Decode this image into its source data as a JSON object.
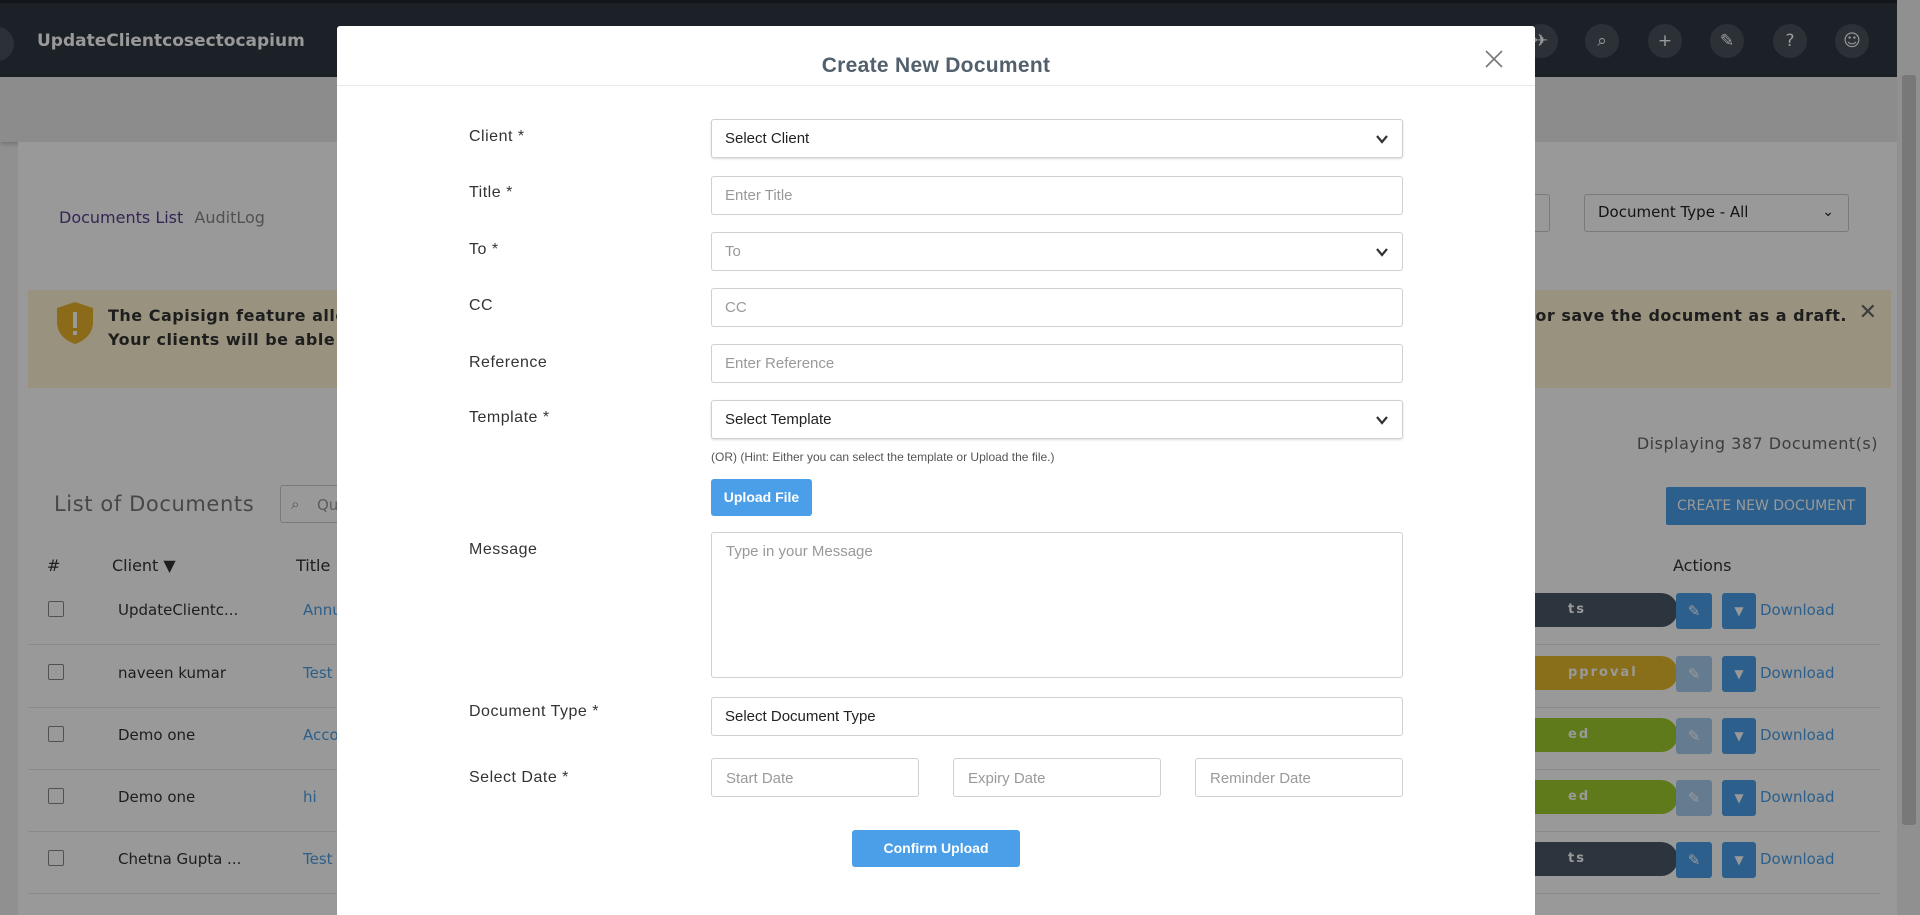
{
  "app": {
    "title": "UpdateClientcosectocapium",
    "tabs": [
      {
        "label": "Documents List"
      },
      {
        "label": "AuditLog"
      }
    ],
    "doctype_filter": "Document Type - All"
  },
  "notice": {
    "line1": "The Capisign feature allows",
    "line2": "Your clients will be able to s",
    "line1_right": "eject or save the document as a draft."
  },
  "list": {
    "displaying": "Displaying 387 Document(s)",
    "title": "List of Documents",
    "search_placeholder": "Qu",
    "create_button": "CREATE NEW DOCUMENT",
    "headers": {
      "num": "#",
      "client": "Client ▼",
      "title": "Title",
      "actions": "Actions"
    },
    "rows": [
      {
        "client": "UpdateClientc...",
        "title": "Annu",
        "status": "ts",
        "status_color": "#4a5866",
        "edit_dim": false,
        "download": "Download"
      },
      {
        "client": "naveen kumar",
        "title": "Test",
        "status": "pproval",
        "status_color": "#e6b92c",
        "edit_dim": true,
        "download": "Download"
      },
      {
        "client": "Demo one",
        "title": "Acco",
        "status": "ed",
        "status_color": "#9ecb2c",
        "edit_dim": true,
        "download": "Download"
      },
      {
        "client": "Demo one",
        "title": "hi",
        "status": "ed",
        "status_color": "#9ecb2c",
        "edit_dim": true,
        "download": "Download"
      },
      {
        "client": "Chetna Gupta ...",
        "title": "Test",
        "status": "ts",
        "status_color": "#4a5866",
        "edit_dim": false,
        "download": "Download"
      }
    ]
  },
  "modal": {
    "title": "Create New Document",
    "fields": {
      "client": {
        "label": "Client *",
        "value": "Select Client"
      },
      "title": {
        "label": "Title *",
        "placeholder": "Enter Title"
      },
      "to": {
        "label": "To *",
        "placeholder": "To"
      },
      "cc": {
        "label": "CC",
        "placeholder": "CC"
      },
      "reference": {
        "label": "Reference",
        "placeholder": "Enter Reference"
      },
      "template": {
        "label": "Template *",
        "value": "Select Template"
      },
      "message": {
        "label": "Message",
        "placeholder": "Type in your Message"
      },
      "document_type": {
        "label": "Document Type *",
        "value": "Select Document Type"
      },
      "select_date": {
        "label": "Select Date *"
      }
    },
    "hint": "(OR)   (Hint: Either you can select the template or Upload the file.)",
    "upload_button": "Upload File",
    "dates": {
      "start": "Start Date",
      "expiry": "Expiry Date",
      "reminder": "Reminder Date"
    },
    "confirm_button": "Confirm Upload"
  },
  "colors": {
    "accent": "#4a9fe8",
    "topbar": "#2f3742",
    "title": "#52606d"
  }
}
